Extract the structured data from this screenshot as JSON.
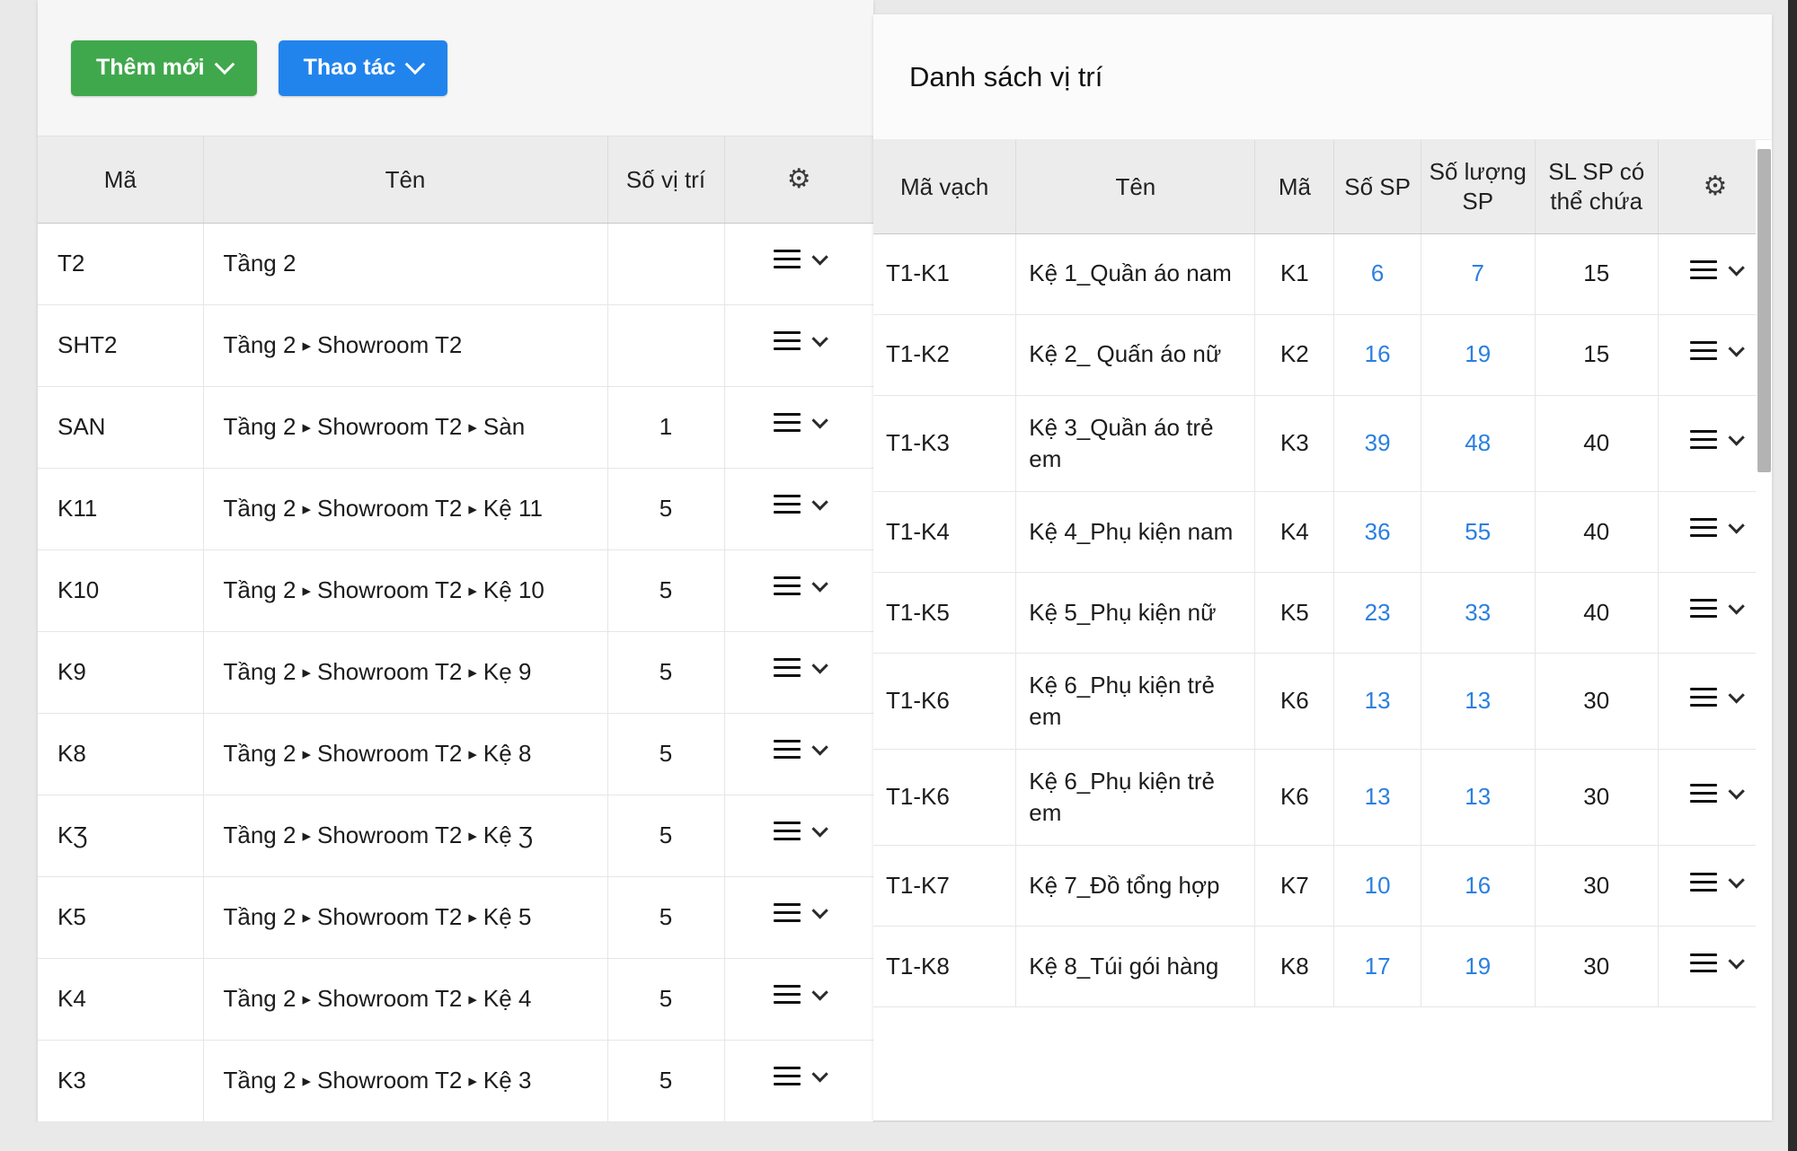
{
  "toolbar": {
    "add_button": "Thêm mới",
    "action_button": "Thao tác",
    "caret_icon": "chevron-down-icon"
  },
  "left_table": {
    "columns": [
      "Mã",
      "Tên",
      "Số vị trí",
      "gear-icon"
    ],
    "settings_icon": "⚙",
    "rows": [
      {
        "ma": "T2",
        "ten_parts": [
          "Tầng 2"
        ],
        "so": ""
      },
      {
        "ma": "SHT2",
        "ten_parts": [
          "Tầng 2",
          "Showroom T2"
        ],
        "so": ""
      },
      {
        "ma": "SAN",
        "ten_parts": [
          "Tầng 2",
          "Showroom T2",
          "Sàn"
        ],
        "so": "1"
      },
      {
        "ma": "K11",
        "ten_parts": [
          "Tầng 2",
          "Showroom T2",
          "Kệ 11"
        ],
        "so": "5"
      },
      {
        "ma": "K10",
        "ten_parts": [
          "Tầng 2",
          "Showroom T2",
          "Kệ 10"
        ],
        "so": "5"
      },
      {
        "ma": "K9",
        "ten_parts": [
          "Tầng 2",
          "Showroom T2",
          "Kẹ 9"
        ],
        "so": "5"
      },
      {
        "ma": "K8",
        "ten_parts": [
          "Tầng 2",
          "Showroom T2",
          "Kệ 8"
        ],
        "so": "5"
      },
      {
        "ma": "KƷ",
        "ten_parts": [
          "Tầng 2",
          "Showroom T2",
          "Kệ Ʒ"
        ],
        "so": "5"
      },
      {
        "ma": "K5",
        "ten_parts": [
          "Tầng 2",
          "Showroom T2",
          "Kệ 5"
        ],
        "so": "5"
      },
      {
        "ma": "K4",
        "ten_parts": [
          "Tầng 2",
          "Showroom T2",
          "Kệ 4"
        ],
        "so": "5"
      },
      {
        "ma": "K3",
        "ten_parts": [
          "Tầng 2",
          "Showroom T2",
          "Kệ 3"
        ],
        "so": "5"
      }
    ]
  },
  "right_panel": {
    "title": "Danh sách vị trí",
    "columns": [
      "Mã vạch",
      "Tên",
      "Mã",
      "Số SP",
      "Số lượng SP",
      "SL SP có thể chứa",
      "gear-icon"
    ],
    "settings_icon": "⚙",
    "rows": [
      {
        "ma_vach": "T1-K1",
        "ten": "Kệ 1_Quần áo nam",
        "ma": "K1",
        "so_sp": "6",
        "so_luong_sp": "7",
        "suc_chua": "15"
      },
      {
        "ma_vach": "T1-K2",
        "ten": "Kệ 2_ Quấn áo nữ",
        "ma": "K2",
        "so_sp": "16",
        "so_luong_sp": "19",
        "suc_chua": "15"
      },
      {
        "ma_vach": "T1-K3",
        "ten": "Kệ 3_Quần áo trẻ em",
        "ma": "K3",
        "so_sp": "39",
        "so_luong_sp": "48",
        "suc_chua": "40"
      },
      {
        "ma_vach": "T1-K4",
        "ten": "Kệ 4_Phụ kiện nam",
        "ma": "K4",
        "so_sp": "36",
        "so_luong_sp": "55",
        "suc_chua": "40"
      },
      {
        "ma_vach": "T1-K5",
        "ten": "Kệ 5_Phụ kiện nữ",
        "ma": "K5",
        "so_sp": "23",
        "so_luong_sp": "33",
        "suc_chua": "40"
      },
      {
        "ma_vach": "T1-K6",
        "ten": "Kệ 6_Phụ kiện trẻ em",
        "ma": "K6",
        "so_sp": "13",
        "so_luong_sp": "13",
        "suc_chua": "30"
      },
      {
        "ma_vach": "T1-K6",
        "ten": "Kệ 6_Phụ kiện trẻ em",
        "ma": "K6",
        "so_sp": "13",
        "so_luong_sp": "13",
        "suc_chua": "30"
      },
      {
        "ma_vach": "T1-K7",
        "ten": "Kệ 7_Đồ tổng hợp",
        "ma": "K7",
        "so_sp": "10",
        "so_luong_sp": "16",
        "suc_chua": "30"
      },
      {
        "ma_vach": "T1-K8",
        "ten": "Kệ 8_Túi gói hàng",
        "ma": "K8",
        "so_sp": "17",
        "so_luong_sp": "19",
        "suc_chua": "30"
      }
    ]
  },
  "colors": {
    "green_button": "#40a84c",
    "blue_button": "#2184ed",
    "link_blue": "#2a7fe0",
    "header_bg": "#ececec",
    "page_bg": "#e9e9e9"
  },
  "row_menu": {
    "menu_icon": "hamburger-icon",
    "caret_icon": "chevron-down-icon"
  }
}
